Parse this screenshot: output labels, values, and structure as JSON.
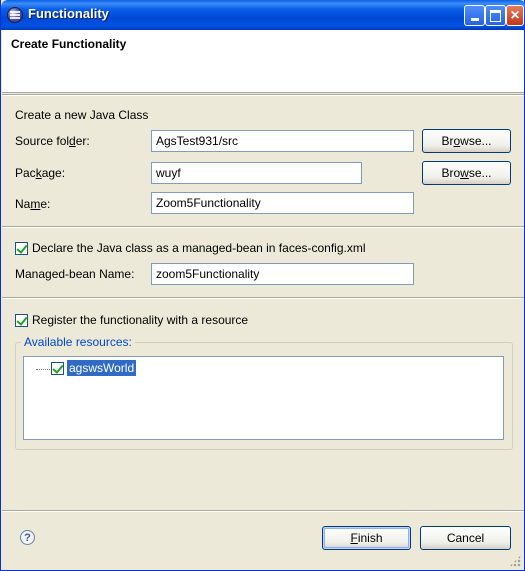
{
  "window": {
    "title": "Functionality"
  },
  "banner": {
    "heading": "Create Functionality"
  },
  "form": {
    "intro": "Create a new Java Class",
    "source_folder_label_pre": "Source fol",
    "source_folder_label_mn": "d",
    "source_folder_label_post": "er:",
    "source_folder_value": "AgsTest931/src",
    "package_label_pre": "Pac",
    "package_label_mn": "k",
    "package_label_post": "age:",
    "package_value": "wuyf",
    "name_label_pre": "Na",
    "name_label_mn": "m",
    "name_label_post": "e:",
    "name_value": "Zoom5Functionality",
    "browse_pre": "Br",
    "browse_mn": "o",
    "browse_post": "wse...",
    "browse2_pre": "Bro",
    "browse2_mn": "w",
    "browse2_post": "se...",
    "managed_bean_checkbox_label": "Declare the Java class as a managed-bean in faces-config.xml",
    "managed_bean_checked": true,
    "managed_bean_name_label": "Managed-bean Name:",
    "managed_bean_name_value": "zoom5Functionality",
    "register_checkbox_label": "Register the functionality with a resource",
    "register_checked": true
  },
  "resources": {
    "group_title": "Available resources:",
    "items": [
      {
        "label": "agswsWorld",
        "checked": true,
        "selected": true
      }
    ]
  },
  "footer": {
    "help_glyph": "?",
    "finish_mn": "F",
    "finish_post": "inish",
    "cancel_label": "Cancel"
  },
  "colors": {
    "titlebar": "#0a5fe8",
    "dialog_bg": "#ece9d8",
    "selection": "#316ac5",
    "group_title": "#0046d5",
    "checkmark": "#21a121"
  }
}
